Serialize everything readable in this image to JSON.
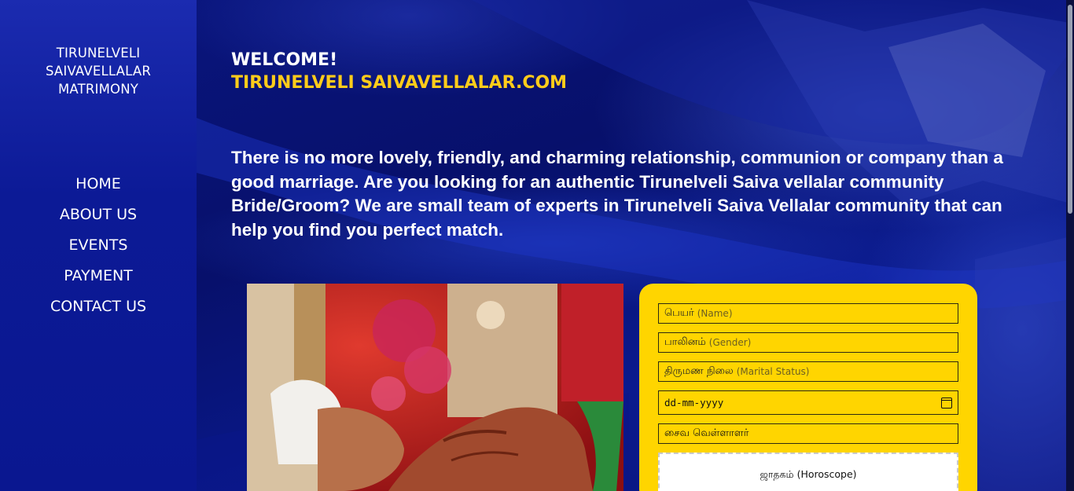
{
  "sidebar": {
    "brand_line1": "TIRUNELVELI",
    "brand_line2": "SAIVAVELLALAR",
    "brand_line3": "MATRIMONY",
    "nav": [
      {
        "label": "HOME"
      },
      {
        "label": "ABOUT US"
      },
      {
        "label": "EVENTS"
      },
      {
        "label": "PAYMENT"
      },
      {
        "label": "CONTACT US"
      }
    ]
  },
  "hero": {
    "welcome": "WELCOME!",
    "site_name": "TIRUNELVELI SAIVAVELLALAR.COM",
    "intro": "There is no more lovely, friendly, and charming relationship, communion or company than a good marriage. Are you looking for an authentic Tirunelveli Saiva vellalar community Bride/Groom? We are small team of experts in Tirunelveli Saiva Vellalar community that can help you find you perfect match."
  },
  "form": {
    "name_ta": "பெயர்",
    "name_en": "(Name)",
    "gender_ta": "பாலினம்",
    "gender_en": "(Gender)",
    "marital_ta": "திருமண நிலை",
    "marital_en": "(Marital Status)",
    "dob_placeholder": "dd-mm-yyyy",
    "caste_value": "சைவ வெள்ளாளர்",
    "horoscope_label": "ஜாதகம் (Horoscope)"
  },
  "colors": {
    "accent_yellow": "#ffcc1a",
    "form_bg": "#ffd500",
    "sidebar_blue": "#0c1a96",
    "page_blue": "#06106a"
  },
  "icons": {
    "date_picker": "calendar-icon"
  }
}
